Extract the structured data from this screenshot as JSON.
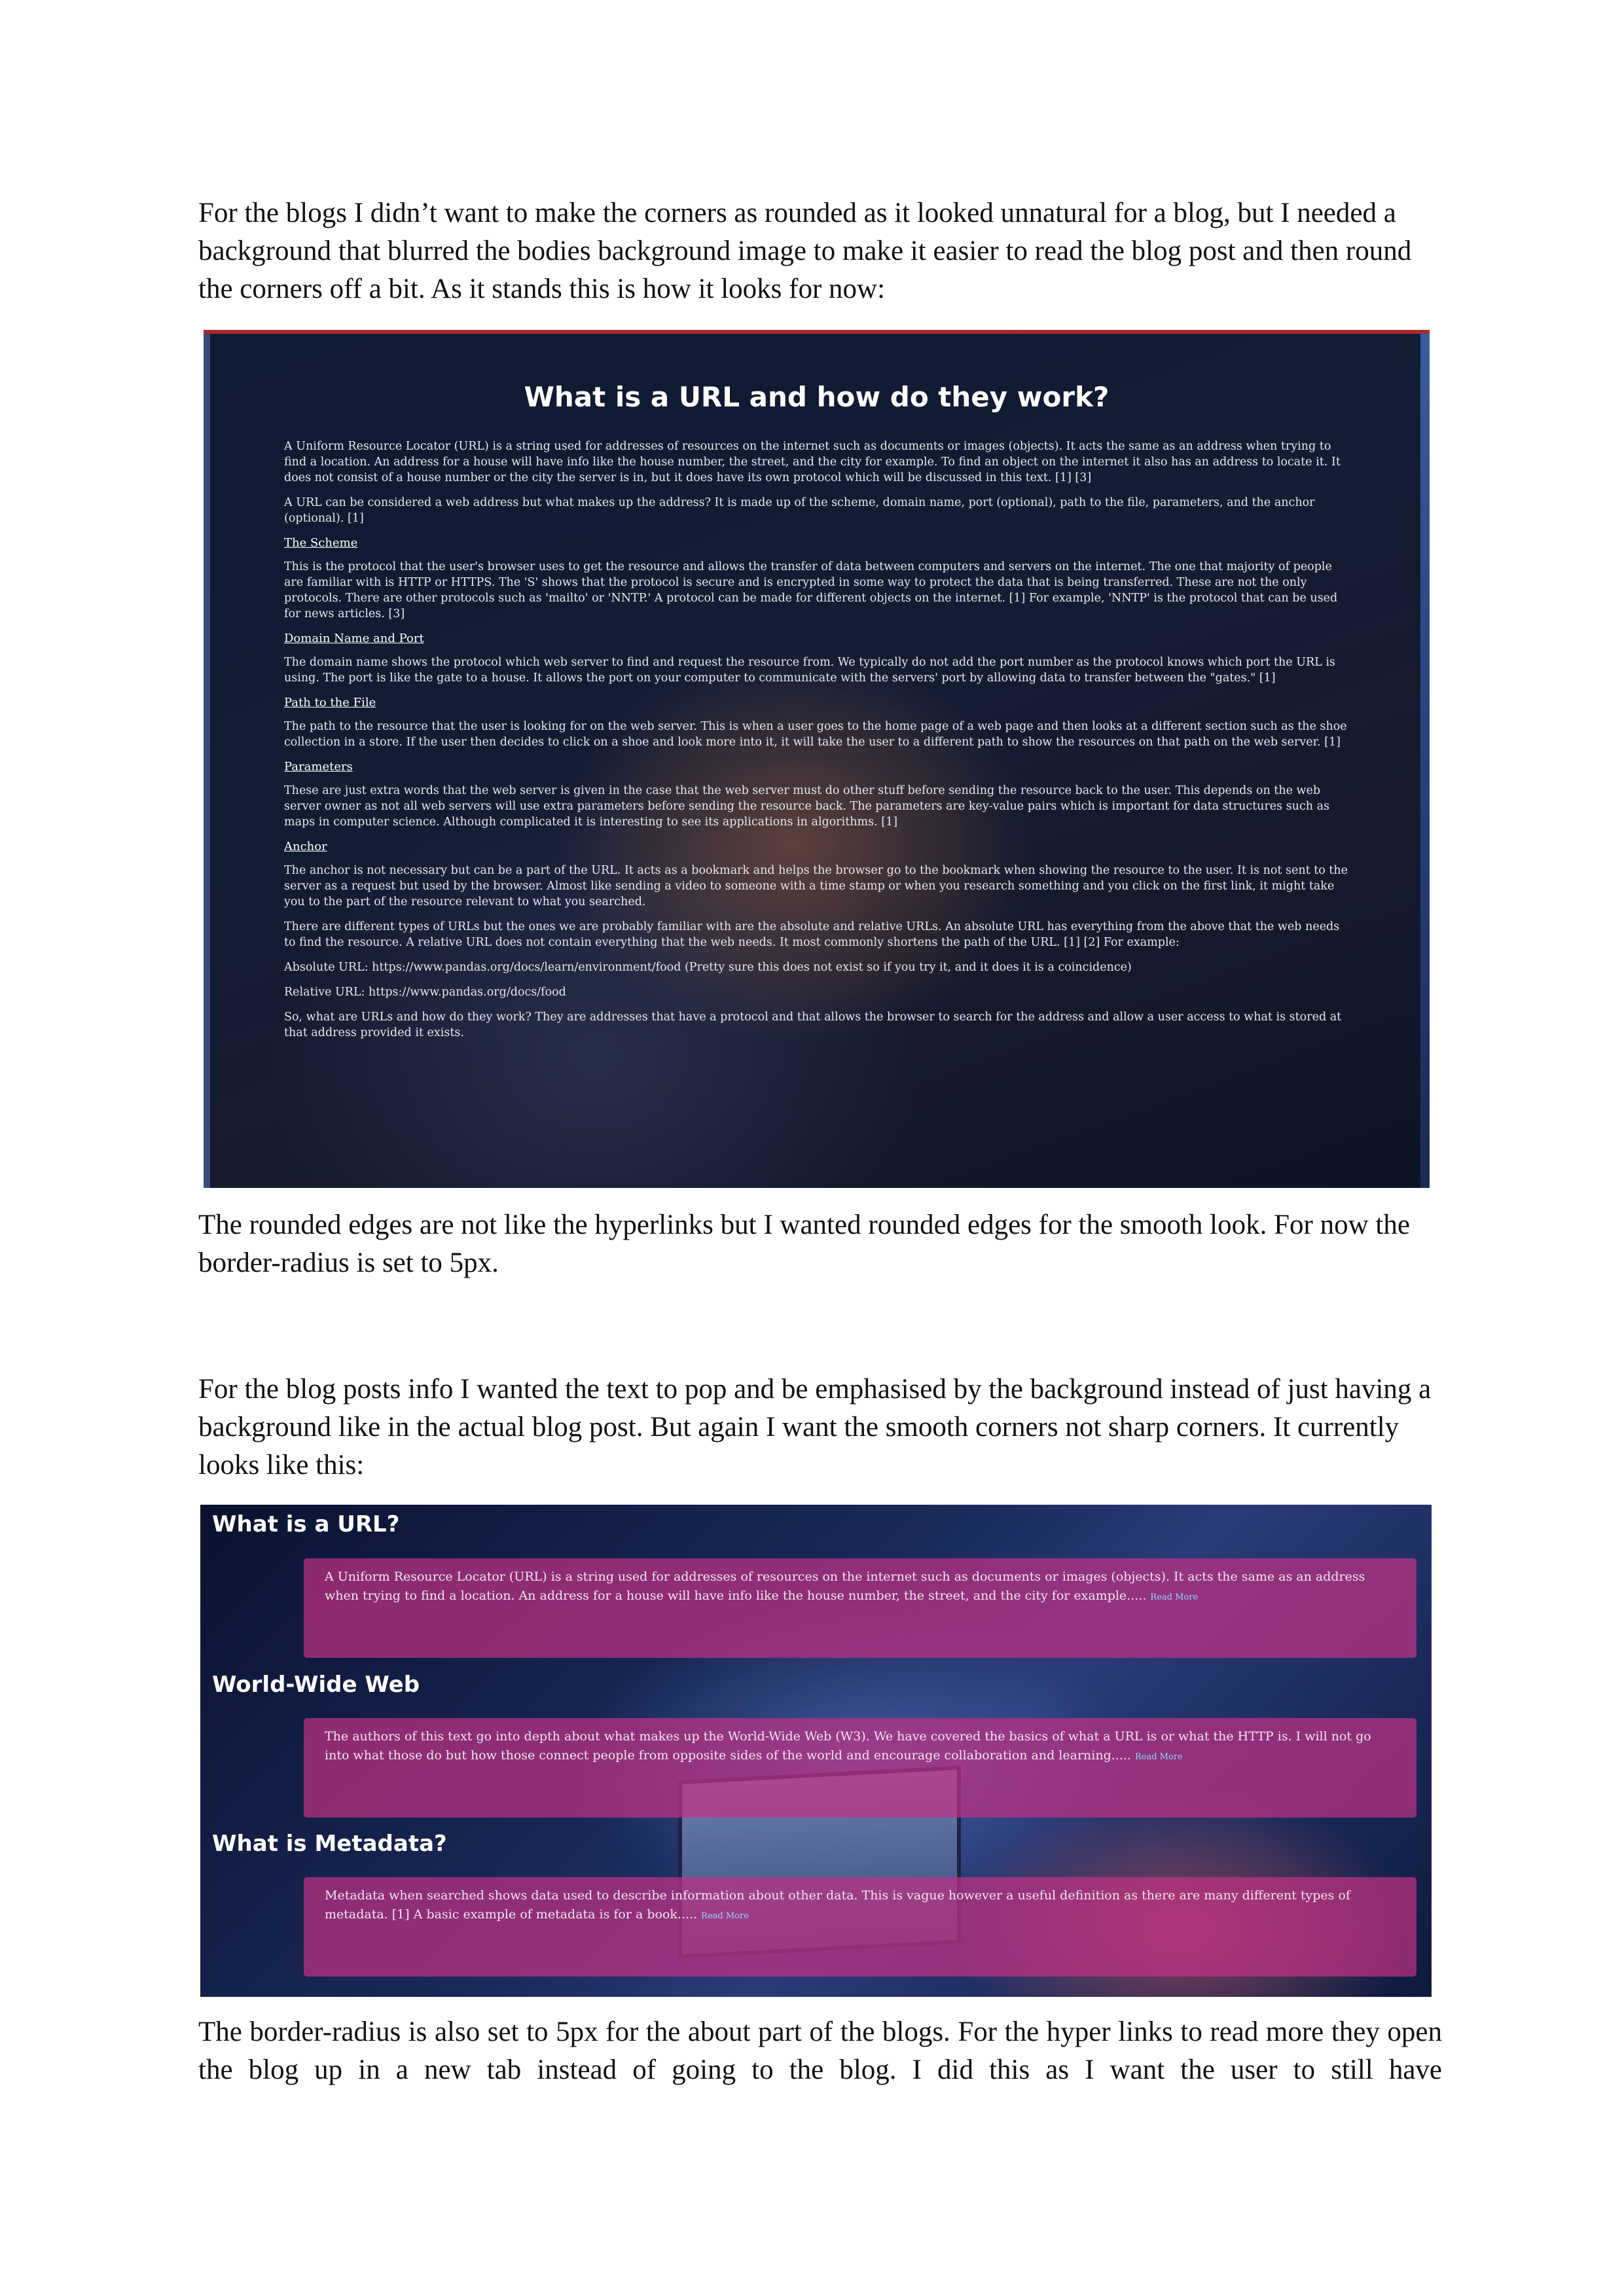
{
  "paragraphs": {
    "p1": "For the blogs I didn’t want to make the corners as rounded as it looked unnatural for a blog, but I needed a background that blurred the bodies background image to make it easier to read the blog post and then round the corners off a bit. As it stands this is how it looks for now:",
    "p2": "The rounded edges are not like the hyperlinks but I wanted rounded edges for the smooth look. For now the border-radius is set to 5px.",
    "p3": "For the blog posts info I wanted the text to pop and be emphasised by the background instead of just having a background like in the actual blog post. But again I want the smooth corners not sharp corners. It currently looks like this:",
    "p4": "The border-radius is also set to 5px for the about part of the blogs. For the hyper links to read more they open the blog up in a new tab instead of going to the blog. I did this as I want the user to still have"
  },
  "blog_post": {
    "title": "What is a URL and how do they work?",
    "intro1": "A Uniform Resource Locator (URL) is a string used for addresses of resources on the internet such as documents or images (objects). It acts the same as an address when trying to find a location. An address for a house will have info like the house number, the street, and the city for example. To find an object on the internet it also has an address to locate it. It does not consist of a house number or the city the server is in, but it does have its own protocol which will be discussed in this text. [1] [3]",
    "intro2": "A URL can be considered a web address but what makes up the address? It is made up of the scheme, domain name, port (optional), path to the file, parameters, and the anchor (optional). [1]",
    "h_scheme": "The Scheme",
    "scheme": "This is the protocol that the user's browser uses to get the resource and allows the transfer of data between computers and servers on the internet. The one that majority of people are familiar with is HTTP or HTTPS. The 'S' shows that the protocol is secure and is encrypted in some way to protect the data that is being transferred. These are not the only protocols. There are other protocols such as 'mailto' or 'NNTP.' A protocol can be made for different objects on the internet. [1] For example, 'NNTP' is the protocol that can be used for news articles. [3]",
    "h_domain": "Domain Name and Port",
    "domain": "The domain name shows the protocol which web server to find and request the resource from. We typically do not add the port number as the protocol knows which port the URL is using. The port is like the gate to a house. It allows the port on your computer to communicate with the servers' port by allowing data to transfer between the \"gates.\" [1]",
    "h_path": "Path to the File",
    "path": "The path to the resource that the user is looking for on the web server. This is when a user goes to the home page of a web page and then looks at a different section such as the shoe collection in a store. If the user then decides to click on a shoe and look more into it, it will take the user to a different path to show the resources on that path on the web server. [1]",
    "h_params": "Parameters",
    "params": "These are just extra words that the web server is given in the case that the web server must do other stuff before sending the resource back to the user. This depends on the web server owner as not all web servers will use extra parameters before sending the resource back. The parameters are key-value pairs which is important for data structures such as maps in computer science. Although complicated it is interesting to see its applications in algorithms. [1]",
    "h_anchor": "Anchor",
    "anchor": "The anchor is not necessary but can be a part of the URL. It acts as a bookmark and helps the browser go to the bookmark when showing the resource to the user. It is not sent to the server as a request but used by the browser. Almost like sending a video to someone with a time stamp or when you research something and you click on the first link, it might take you to the part of the resource relevant to what you searched.",
    "types": "There are different types of URLs but the ones we are probably familiar with are the absolute and relative URLs. An absolute URL has everything from the above that the web needs to find the resource. A relative URL does not contain everything that the web needs. It most commonly shortens the path of the URL. [1] [2] For example:",
    "absolute": "Absolute URL: https://www.pandas.org/docs/learn/environment/food (Pretty sure this does not exist so if you try it, and it does it is a coincidence)",
    "relative": "Relative URL: https://www.pandas.org/docs/food",
    "summary": "So, what are URLs and how do they work? They are addresses that have a protocol and that allows the browser to search for the address and allow a user access to what is stored at that address provided it exists."
  },
  "blog_list": {
    "items": [
      {
        "title": "What is a URL?",
        "text": "A Uniform Resource Locator (URL) is a string used for addresses of resources on the internet such as documents or images (objects). It acts the same as an address when trying to find a location. An address for a house will have info like the house number, the street, and the city for example.....",
        "link": "Read More"
      },
      {
        "title": "World-Wide Web",
        "text": "The authors of this text go into depth about what makes up the World-Wide Web (W3). We have covered the basics of what a URL is or what the HTTP is. I will not go into what those do but how those connect people from opposite sides of the world and encourage collaboration and learning.....",
        "link": "Read More"
      },
      {
        "title": "What is Metadata?",
        "text": "Metadata when searched shows data used to describe information about other data. This is vague however a useful definition as there are many different types of metadata. [1] A basic example of metadata is for a book.....",
        "link": "Read More"
      }
    ]
  }
}
